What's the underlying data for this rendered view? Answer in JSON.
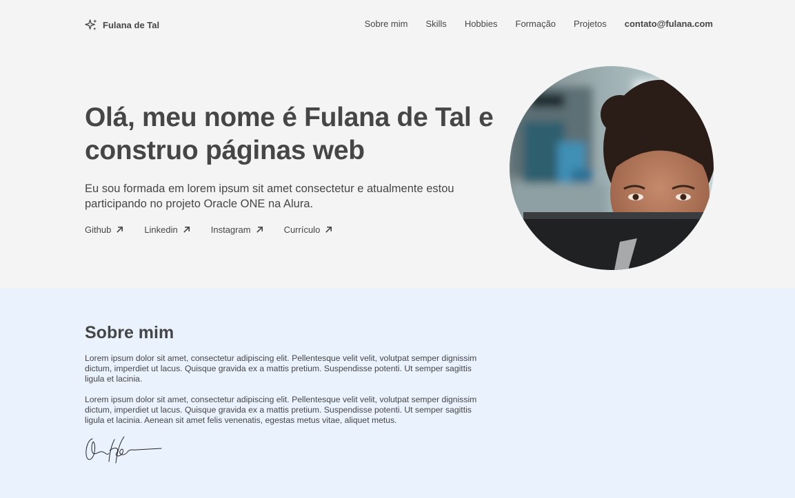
{
  "header": {
    "brand": "Fulana de Tal",
    "brand_icon": "sparkles-icon",
    "nav": [
      "Sobre mim",
      "Skills",
      "Hobbies",
      "Formação",
      "Projetos"
    ],
    "contact": "contato@fulana.com"
  },
  "hero": {
    "title": "Olá, meu nome é Fulana de Tal e construo páginas web",
    "description": "Eu sou formada em lorem ipsum sit amet consectetur e atualmente estou participando no projeto Oracle ONE na Alura.",
    "links": [
      "Github",
      "Linkedin",
      "Instagram",
      "Currículo"
    ],
    "link_icon": "arrow-up-right-icon"
  },
  "about": {
    "title": "Sobre mim",
    "paragraphs": [
      "Lorem ipsum dolor sit amet, consectetur adipiscing elit. Pellentesque velit velit, volutpat semper dignissim dictum, imperdiet ut lacus. Quisque gravida ex a mattis pretium. Suspendisse potenti. Ut semper sagittis ligula et lacinia.",
      "Lorem ipsum dolor sit amet, consectetur adipiscing elit. Pellentesque velit velit, volutpat semper dignissim dictum, imperdiet ut lacus. Quisque gravida ex a mattis pretium. Suspendisse potenti. Ut semper sagittis ligula et lacinia. Aenean sit amet felis venenatis, egestas metus vitae, aliquet metus."
    ]
  },
  "colors": {
    "text": "#464646",
    "hero_background": "#f4f4f4",
    "about_background": "#eaf2fd"
  }
}
